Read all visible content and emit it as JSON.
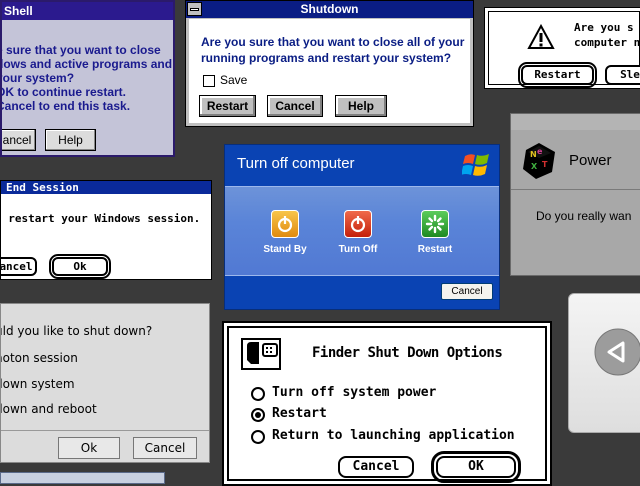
{
  "shell": {
    "title": "Shell",
    "lines": [
      "e sure that you want to close",
      "dows and active programs and",
      "your system?",
      "OK to continue restart.",
      "Cancel to end this task."
    ],
    "cancel_label": "ancel",
    "help_label": "Help"
  },
  "shutdown": {
    "title": "Shutdown",
    "lines": [
      "Are you sure that you want to close all of your",
      "running programs and restart your system?"
    ],
    "save_label": "Save",
    "restart_label": "Restart",
    "cancel_label": "Cancel",
    "help_label": "Help"
  },
  "mac_alert": {
    "lines": [
      "Are you s",
      "computer n"
    ],
    "restart_label": "Restart",
    "sleep_label": "Sle"
  },
  "xp": {
    "title": "Turn off computer",
    "standby_label": "Stand By",
    "turnoff_label": "Turn Off",
    "restart_label": "Restart",
    "cancel_label": "Cancel",
    "colors": {
      "standby": "#f2a51c",
      "turnoff": "#d9321a",
      "restart": "#2fa83a"
    }
  },
  "end_session": {
    "title": "End Session",
    "message": "l restart your Windows session.",
    "cancel_label": "ancel",
    "ok_label": "Ok"
  },
  "next": {
    "title": "Power",
    "message": "Do you really wan"
  },
  "photon": {
    "question": "uld you like to shut down?",
    "options": [
      "hoton session",
      "down system",
      "down and reboot"
    ],
    "ok_label": "Ok",
    "cancel_label": "Cancel"
  },
  "finder": {
    "title": "Finder Shut Down Options",
    "options": [
      {
        "label": "Turn off system power",
        "selected": false
      },
      {
        "label": "Restart",
        "selected": true
      },
      {
        "label": "Return to launching application",
        "selected": false
      }
    ],
    "cancel_label": "Cancel",
    "ok_label": "OK"
  }
}
